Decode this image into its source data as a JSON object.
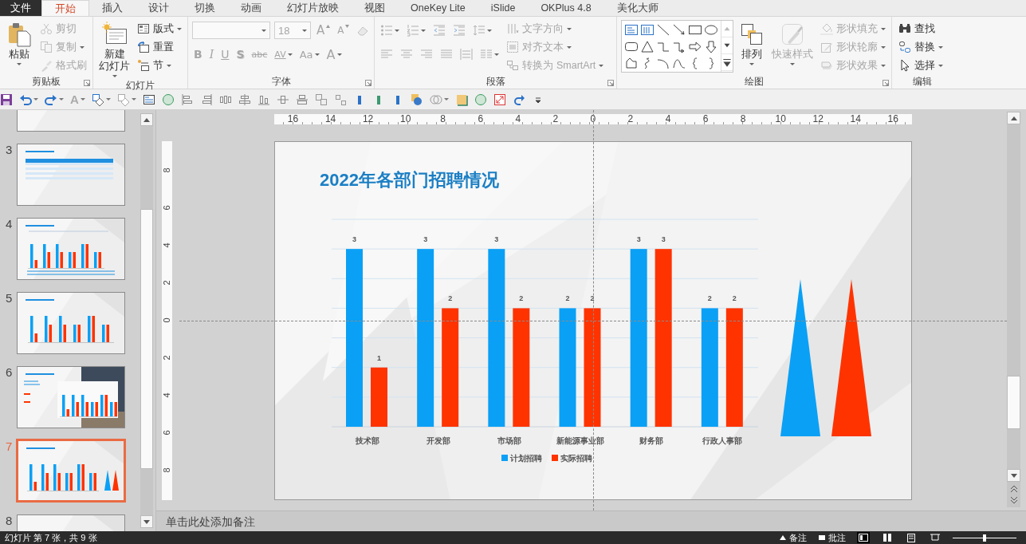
{
  "tabs": [
    {
      "label": "文件",
      "kind": "file",
      "selected": false
    },
    {
      "label": "开始",
      "kind": "tab",
      "selected": true
    },
    {
      "label": "插入",
      "kind": "tab",
      "selected": false
    },
    {
      "label": "设计",
      "kind": "tab",
      "selected": false
    },
    {
      "label": "切换",
      "kind": "tab",
      "selected": false
    },
    {
      "label": "动画",
      "kind": "tab",
      "selected": false
    },
    {
      "label": "幻灯片放映",
      "kind": "tab",
      "selected": false
    },
    {
      "label": "视图",
      "kind": "tab",
      "selected": false
    },
    {
      "label": "OneKey Lite",
      "kind": "tab",
      "selected": false
    },
    {
      "label": "iSlide",
      "kind": "tab",
      "selected": false
    },
    {
      "label": "OKPlus 4.8",
      "kind": "tab",
      "selected": false
    },
    {
      "label": "美化大师",
      "kind": "tab",
      "selected": false
    }
  ],
  "ribbon_groups": [
    {
      "label": "剪贴板",
      "launcher": true,
      "sections": [
        {
          "kind": "big",
          "label": "粘贴",
          "dropdown": true,
          "disabled": false
        },
        {
          "kind": "stack",
          "items": [
            {
              "label": "剪切",
              "dropdown": false,
              "disabled": true
            },
            {
              "label": "复制",
              "dropdown": true,
              "disabled": true
            },
            {
              "label": "格式刷",
              "dropdown": false,
              "disabled": true
            }
          ]
        }
      ]
    },
    {
      "label": "幻灯片",
      "launcher": false,
      "sections": [
        {
          "kind": "big",
          "label": "新建",
          "label_2": "幻灯片",
          "dropdown": true,
          "disabled": false
        },
        {
          "kind": "stack",
          "items": [
            {
              "label": "版式",
              "dropdown": true,
              "disabled": false
            },
            {
              "label": "重置",
              "dropdown": false,
              "disabled": false
            },
            {
              "label": "节",
              "dropdown": true,
              "disabled": false
            }
          ]
        }
      ]
    },
    {
      "label": "字体",
      "launcher": true,
      "sections": [
        {
          "kind": "lines",
          "lines": [
            {
              "items": [
                {
                  "kind": "field",
                  "dropdown": true,
                  "disabled": true
                },
                {
                  "kind": "field",
                  "value": "18",
                  "dropdown": true,
                  "disabled": true
                },
                {
                  "kind": "grow",
                  "label": "A",
                  "dropdown": false,
                  "disabled": true
                },
                {
                  "kind": "shrink",
                  "label": "A",
                  "dropdown": false,
                  "disabled": true
                },
                {
                  "kind": "icon",
                  "dropdown": false,
                  "disabled": true
                }
              ]
            },
            {
              "items": [
                {
                  "kind": "bold",
                  "label": "B",
                  "dropdown": false,
                  "disabled": true
                },
                {
                  "kind": "italic",
                  "label": "I",
                  "dropdown": false,
                  "disabled": true
                },
                {
                  "kind": "underline",
                  "label": "U",
                  "dropdown": false,
                  "disabled": true
                },
                {
                  "kind": "shadow",
                  "label": "S",
                  "dropdown": false,
                  "disabled": true
                },
                {
                  "kind": "strike",
                  "label": "abc",
                  "dropdown": false,
                  "disabled": true
                },
                {
                  "kind": "spacing",
                  "label": "AV",
                  "dropdown": true,
                  "disabled": true
                },
                {
                  "kind": "case",
                  "label": "Aa",
                  "dropdown": true,
                  "disabled": true
                },
                {
                  "kind": "color",
                  "label": "A",
                  "dropdown": true,
                  "disabled": true
                }
              ]
            }
          ]
        }
      ]
    },
    {
      "label": "段落",
      "launcher": true,
      "sections": [
        {
          "kind": "lines",
          "lines": [
            {
              "items": [
                {
                  "kind": "icon",
                  "dropdown": true,
                  "disabled": true
                },
                {
                  "kind": "icon",
                  "dropdown": true,
                  "disabled": true
                },
                {
                  "kind": "icon",
                  "dropdown": false,
                  "disabled": true
                },
                {
                  "kind": "icon",
                  "dropdown": false,
                  "disabled": true
                },
                {
                  "kind": "icon",
                  "dropdown": true,
                  "disabled": true
                }
              ]
            },
            {
              "items": [
                {
                  "kind": "icon",
                  "dropdown": false,
                  "disabled": true
                },
                {
                  "kind": "icon",
                  "dropdown": false,
                  "disabled": true
                },
                {
                  "kind": "icon",
                  "dropdown": false,
                  "disabled": true
                },
                {
                  "kind": "icon",
                  "dropdown": false,
                  "disabled": true
                },
                {
                  "kind": "icon",
                  "dropdown": false,
                  "disabled": true
                },
                {
                  "kind": "icon",
                  "dropdown": true,
                  "disabled": true
                }
              ]
            }
          ]
        },
        {
          "kind": "stack",
          "items": [
            {
              "label": "文字方向",
              "dropdown": true,
              "disabled": true
            },
            {
              "label": "对齐文本",
              "dropdown": true,
              "disabled": true
            },
            {
              "label": "转换为 SmartArt",
              "dropdown": true,
              "disabled": true
            }
          ]
        }
      ]
    },
    {
      "label": "绘图",
      "launcher": true,
      "sections": [
        {
          "kind": "gallery"
        },
        {
          "kind": "big",
          "label": "排列",
          "dropdown": true,
          "disabled": false
        },
        {
          "kind": "big",
          "label": "快速样式",
          "dropdown": true,
          "disabled": true
        },
        {
          "kind": "stack",
          "items": [
            {
              "label": "形状填充",
              "dropdown": true,
              "disabled": true
            },
            {
              "label": "形状轮廓",
              "dropdown": true,
              "disabled": true
            },
            {
              "label": "形状效果",
              "dropdown": true,
              "disabled": true
            }
          ]
        }
      ]
    },
    {
      "label": "编辑",
      "launcher": false,
      "sections": [
        {
          "kind": "stack",
          "items": [
            {
              "label": "查找",
              "dropdown": false,
              "disabled": false
            },
            {
              "label": "替换",
              "dropdown": true,
              "disabled": false
            },
            {
              "label": "选择",
              "dropdown": true,
              "disabled": false
            }
          ]
        }
      ]
    }
  ],
  "quick_access": {
    "font_color_label": "A"
  },
  "thumbnails": [
    {
      "kind": "cover",
      "selected": false
    },
    {
      "number": "3",
      "kind": "table",
      "selected": false
    },
    {
      "number": "4",
      "kind": "chart-axis",
      "selected": false
    },
    {
      "number": "5",
      "kind": "chart",
      "selected": false
    },
    {
      "number": "6",
      "kind": "photo-chart",
      "selected": false
    },
    {
      "number": "7",
      "kind": "chart-shapes",
      "selected": true
    },
    {
      "number": "8",
      "kind": "plain",
      "selected": false
    }
  ],
  "rulers": {
    "horizontal": [
      "16",
      "14",
      "12",
      "10",
      "8",
      "6",
      "4",
      "2",
      "0",
      "2",
      "4",
      "6",
      "8",
      "10",
      "12",
      "14",
      "16"
    ],
    "vertical": [
      "8",
      "6",
      "4",
      "2",
      "0",
      "2",
      "4",
      "6",
      "8"
    ]
  },
  "slide": {
    "title": "2022年各部门招聘情况",
    "chart_data": {
      "type": "bar",
      "categories": [
        "技术部",
        "开发部",
        "市场部",
        "新能源事业部",
        "财务部",
        "行政人事部"
      ],
      "series": [
        {
          "name": "计划招聘",
          "color": "#0aa0f5",
          "values": [
            3,
            3,
            3,
            2,
            3,
            2
          ]
        },
        {
          "name": "实际招聘",
          "color": "#ff3300",
          "values": [
            1,
            2,
            2,
            2,
            3,
            2
          ]
        }
      ],
      "ylim": [
        0,
        3.5
      ],
      "data_labels": true,
      "legend": true
    },
    "shapes": [
      {
        "kind": "triangle",
        "color": "#0aa0f5"
      },
      {
        "kind": "triangle",
        "color": "#ff3300"
      }
    ]
  },
  "notes": {
    "placeholder": "单击此处添加备注"
  },
  "status_bar": {
    "text": "幻灯片 第 7 张，共 9 张",
    "buttons": [
      {
        "label": "备注"
      },
      {
        "label": "批注"
      }
    ],
    "zoom": {
      "level": 0.5
    }
  }
}
